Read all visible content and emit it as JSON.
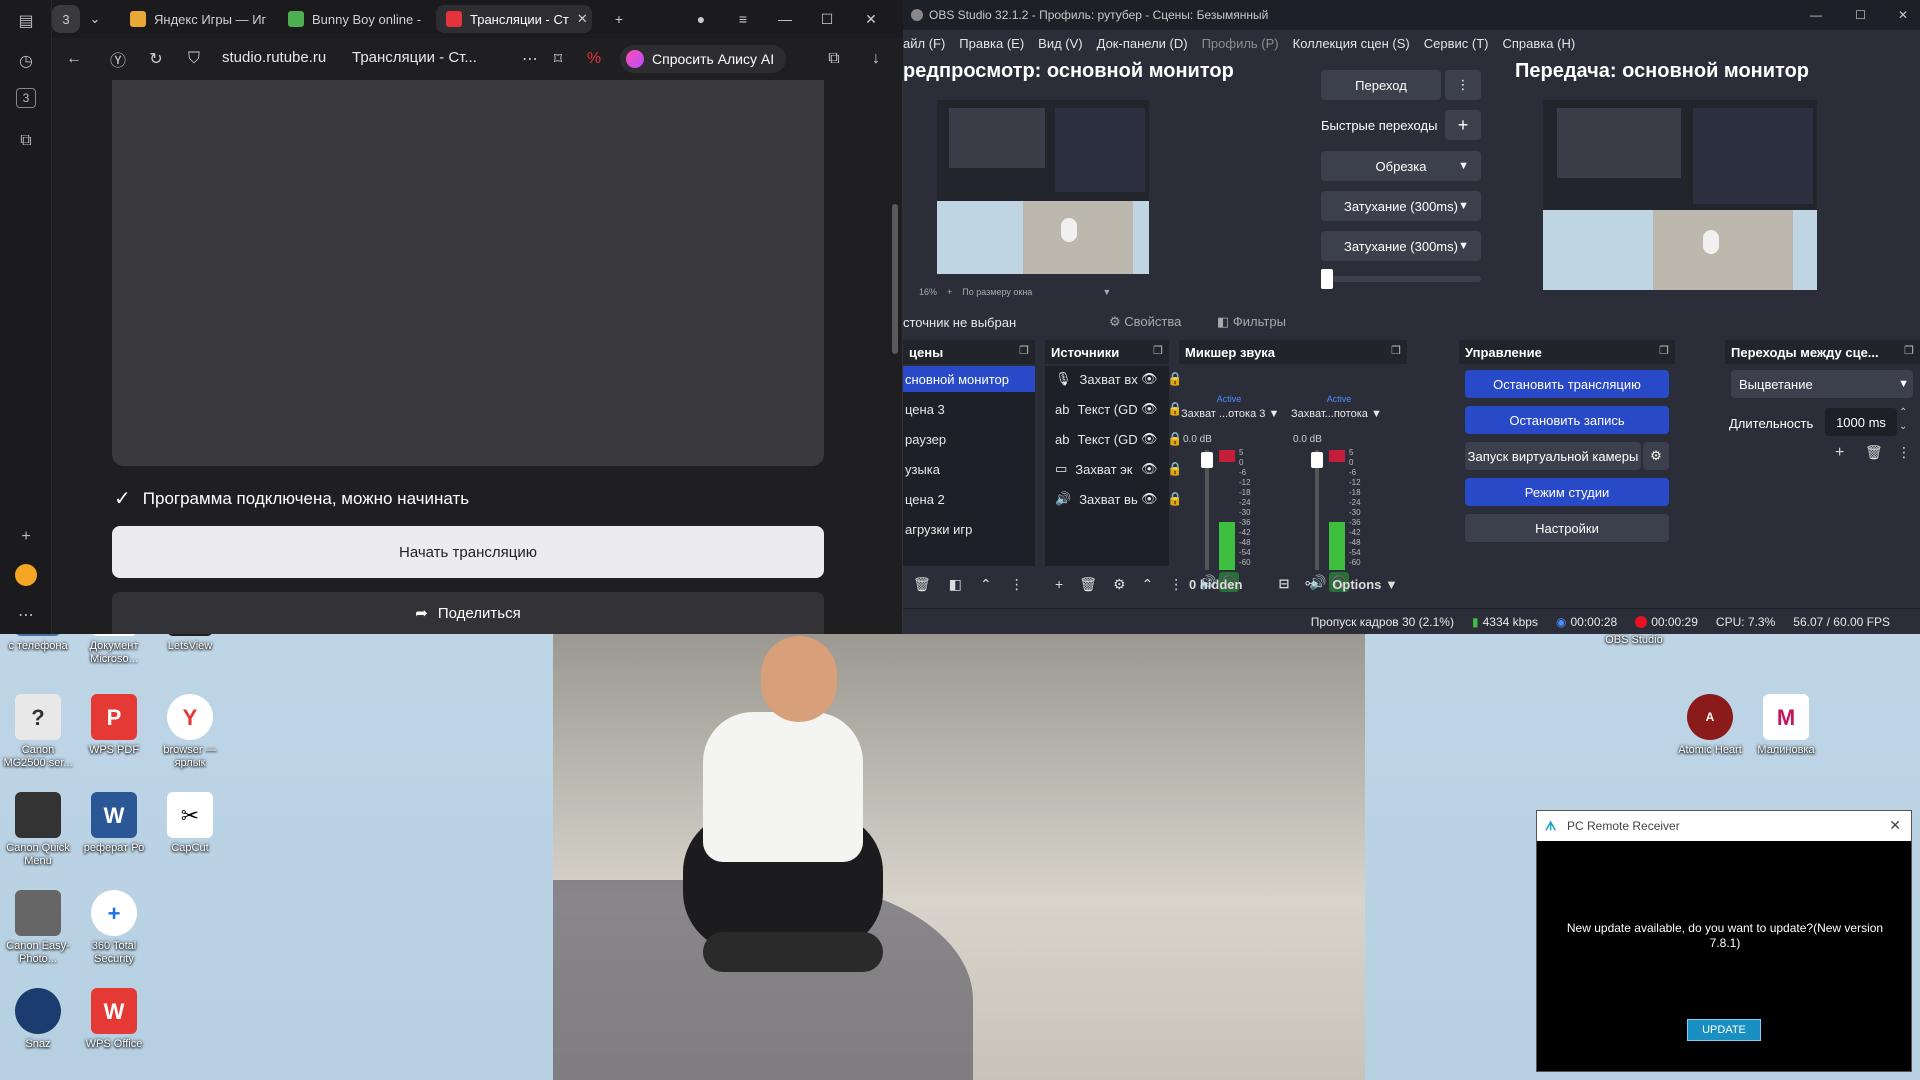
{
  "browser": {
    "tab_counter": "3",
    "tabs": [
      {
        "label": "Яндекс Игры — Иг",
        "color": "#e8a838"
      },
      {
        "label": "Bunny Boy online -",
        "color": "#4caf50"
      },
      {
        "label": "Трансляции - Ст",
        "color": "#e5333b"
      }
    ],
    "address": {
      "url": "studio.rutube.ru",
      "page_title": "Трансляции - Ст...",
      "alice_label": "Спросить Алису AI"
    },
    "sidebar_counter": "3",
    "page": {
      "status_text": "Программа подключена, можно начинать",
      "start_button": "Начать трансляцию",
      "share_button": "Поделиться"
    }
  },
  "obs": {
    "title": "OBS Studio 32.1.2 - Профиль: рутубер - Сцены: Безымянный",
    "menu": [
      {
        "label": "айл (F)",
        "dim": false
      },
      {
        "label": "Правка (E)",
        "dim": false
      },
      {
        "label": "Вид (V)",
        "dim": false
      },
      {
        "label": "Док-панели (D)",
        "dim": false
      },
      {
        "label": "Профиль (P)",
        "dim": true
      },
      {
        "label": "Коллекция сцен (S)",
        "dim": false
      },
      {
        "label": "Сервис (T)",
        "dim": false
      },
      {
        "label": "Справка (H)",
        "dim": false
      }
    ],
    "preview_heading": "редпросмотр: основной монитор",
    "program_heading": "Передача: основной монитор",
    "transition_button": "Переход",
    "quick_transitions": "Быстрые переходы",
    "transitions": [
      "Обрезка",
      "Затухание (300ms)",
      "Затухание (300ms)"
    ],
    "zoom": "16%",
    "fit_mode": "По размеру окна",
    "no_source": "сточник не выбран",
    "properties": "Свойства",
    "filters": "Фильтры",
    "scenes": {
      "header": "цены",
      "items": [
        "сновной монитор",
        "цена 3",
        "раузер",
        "узыка",
        "цена 2",
        "агрузки игр"
      ]
    },
    "sources": {
      "header": "Источники",
      "items": [
        {
          "icon": "🎙",
          "label": "Захват вх"
        },
        {
          "icon": "ab",
          "label": "Текст (GD"
        },
        {
          "icon": "ab",
          "label": "Текст (GD"
        },
        {
          "icon": "▭",
          "label": "Захват эк"
        },
        {
          "icon": "🔊",
          "label": "Захват вь"
        }
      ]
    },
    "mixer": {
      "header": "Микшер звука",
      "channels": [
        {
          "active": "Active",
          "name": "Захват ...отока 3",
          "db": "0.0 dB"
        },
        {
          "active": "Active",
          "name": "Захват...потока",
          "db": "0.0 dB"
        }
      ],
      "scale": [
        "5",
        "0",
        "-6",
        "-12",
        "-18",
        "-24",
        "-30",
        "-36",
        "-42",
        "-48",
        "-54",
        "-60"
      ],
      "hidden": "0 hidden",
      "options": "Options"
    },
    "controls": {
      "header": "Управление",
      "stop_stream": "Остановить трансляцию",
      "stop_record": "Остановить запись",
      "virtual_cam": "Запуск виртуальной камеры",
      "studio_mode": "Режим студии",
      "settings": "Настройки"
    },
    "scene_transitions": {
      "header": "Переходы между сце...",
      "type": "Выцветание",
      "duration_label": "Длительность",
      "duration_value": "1000 ms"
    },
    "status": {
      "dropped": "Пропуск кадров 30 (2.1%)",
      "bitrate": "4334 kbps",
      "stream_time": "00:00:28",
      "rec_time": "00:00:29",
      "cpu": "CPU: 7.3%",
      "fps": "56.07 / 60.00 FPS"
    }
  },
  "desktop": {
    "icons": [
      {
        "label": "с телефона",
        "color": "#4a6fa5",
        "glyph": ""
      },
      {
        "label": "Документ Microso...",
        "color": "#ffffff",
        "glyph": ""
      },
      {
        "label": "LetsView",
        "color": "#1f1f1f",
        "glyph": ""
      },
      {
        "label": "Canon MG2500 ser...",
        "color": "#e8e8e8",
        "glyph": "?"
      },
      {
        "label": "WPS PDF",
        "color": "#e53935",
        "glyph": "P"
      },
      {
        "label": "browser — ярлык",
        "color": "#ffffff",
        "glyph": "Y"
      },
      {
        "label": "Canon Quick Menu",
        "color": "#333333",
        "glyph": ""
      },
      {
        "label": "реферат Ро",
        "color": "#2b5797",
        "glyph": "W"
      },
      {
        "label": "CapCut",
        "color": "#ffffff",
        "glyph": "✂"
      },
      {
        "label": "Canon Easy-Photo...",
        "color": "#666666",
        "glyph": ""
      },
      {
        "label": "360 Total Security",
        "color": "#ffffff",
        "glyph": "+"
      },
      {
        "label": "Snaz",
        "color": "#1a3c6e",
        "glyph": ""
      },
      {
        "label": "WPS Office",
        "color": "#e53935",
        "glyph": "W"
      },
      {
        "label": "OBS Studio",
        "color": "#202020",
        "glyph": ""
      },
      {
        "label": "Atomic Heart",
        "color": "#8b1a1a",
        "glyph": "A"
      },
      {
        "label": "Малиновка",
        "color": "#ffffff",
        "glyph": "M"
      }
    ]
  },
  "pcremote": {
    "title": "PC Remote Receiver",
    "message": "New update available, do you want to update?(New version 7.8.1)",
    "button": "UPDATE"
  }
}
